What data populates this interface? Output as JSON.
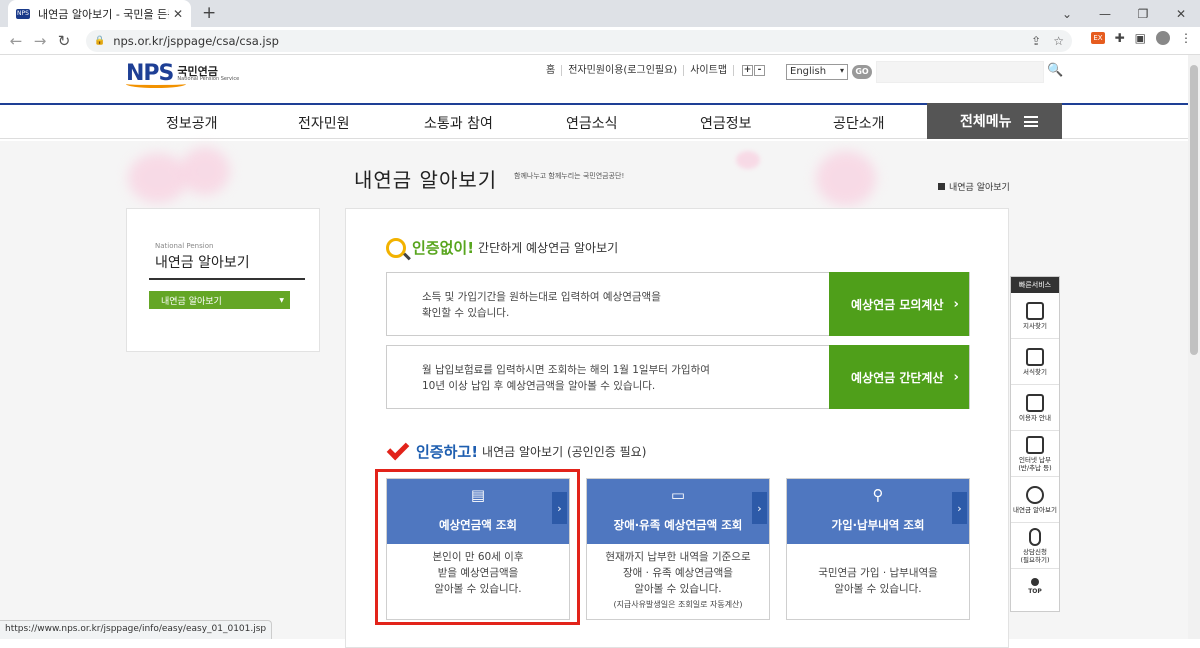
{
  "browser": {
    "tab_title": "내연금 알아보기 - 국민을 든든하게",
    "favicon": "NPS",
    "url": "nps.or.kr/jsppage/csa/csa.jsp",
    "status_url": "https://www.nps.or.kr/jsppage/info/easy/easy_01_0101.jsp"
  },
  "header": {
    "logo": "NPS",
    "logo_kr": "국민연금",
    "logo_en": "National Pension Service",
    "util_links": [
      "홈",
      "전자민원이용(로그인필요)",
      "사이트맵"
    ],
    "font_plus": "+",
    "font_minus": "-",
    "lang": "English",
    "go": "GO"
  },
  "gnb": {
    "items": [
      "정보공개",
      "전자민원",
      "소통과 참여",
      "연금소식",
      "연금정보",
      "공단소개"
    ],
    "all_menu": "전체메뉴"
  },
  "page": {
    "title": "내연금 알아보기",
    "subtitle": "함께나누고 함께누리는 국민연금공단!",
    "breadcrumb": "내연금 알아보기"
  },
  "lnb": {
    "en": "National Pension",
    "ko": "내연금 알아보기",
    "selected": "내연금 알아보기"
  },
  "section1": {
    "highlight": "인증없이!",
    "rest": "간단하게 예상연금 알아보기",
    "rows": [
      {
        "line1": "소득 및 가입기간을 원하는대로 입력하여 예상연금액을",
        "line2": "확인할 수 있습니다.",
        "button": "예상연금 모의계산"
      },
      {
        "line1": "월 납입보험료를 입력하시면 조회하는 해의 1월 1일부터 가입하여",
        "line2": "10년 이상 납입 후 예상연금액을 알아볼 수 있습니다.",
        "button": "예상연금 간단계산"
      }
    ]
  },
  "section2": {
    "highlight": "인증하고!",
    "rest": "내연금 알아보기 (공인인증 필요)",
    "cards": [
      {
        "title": "예상연금액 조회",
        "l1": "본인이 만 60세 이후",
        "l2": "받을 예상연금액을",
        "l3": "알아볼 수 있습니다.",
        "note": ""
      },
      {
        "title": "장애·유족 예상연금액 조회",
        "l1": "현재까지 납부한 내역을 기준으로",
        "l2": "장애 · 유족 예상연금액을",
        "l3": "알아볼 수 있습니다.",
        "note": "(지급사유발생일은 조회일로 자동계산)"
      },
      {
        "title": "가입·납부내역 조회",
        "l1": "",
        "l2": "국민연금 가입 · 납부내역을",
        "l3": "알아볼 수 있습니다.",
        "note": ""
      }
    ]
  },
  "quick": {
    "header": "빠른서비스",
    "items": [
      "지사찾기",
      "서식찾기",
      "이용자 안내",
      "인터넷 납부\n(반/추납 등)",
      "내연금 알아보기",
      "상담신청\n(필요하기)"
    ],
    "top": "TOP"
  }
}
